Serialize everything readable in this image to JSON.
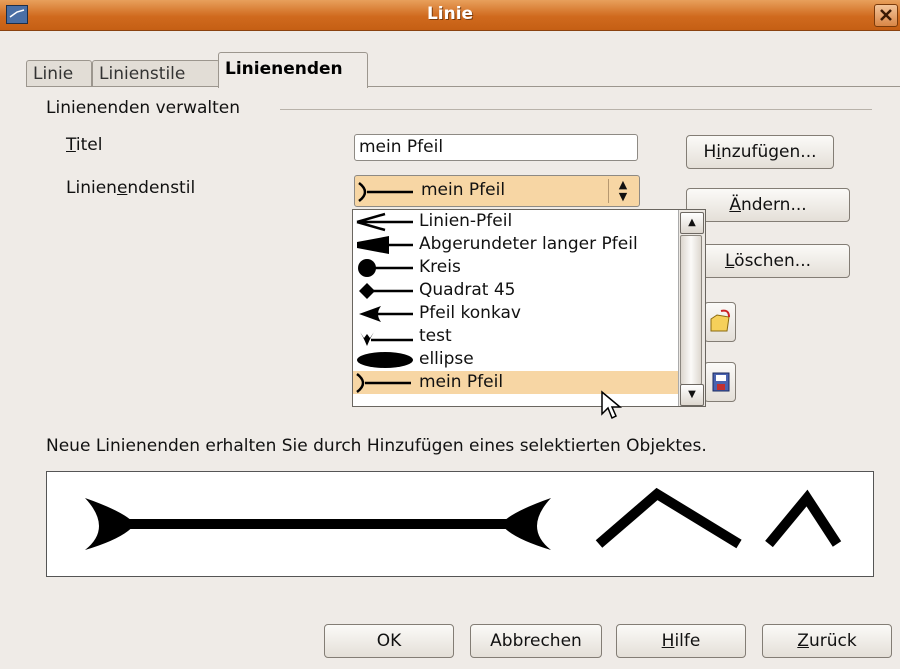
{
  "window": {
    "title": "Linie"
  },
  "tabs": [
    {
      "label": "Linie"
    },
    {
      "label": "Linienstile"
    },
    {
      "label": "Linienenden"
    }
  ],
  "section": {
    "label": "Linienenden verwalten"
  },
  "title_field": {
    "label_first": "T",
    "label_rest": "itel",
    "value": "mein Pfeil"
  },
  "style_field": {
    "label_pre": "Linien",
    "label_u": "e",
    "label_post": "ndenstil",
    "selected": "mein Pfeil"
  },
  "dropdown": {
    "items": [
      {
        "label": "Linien-Pfeil",
        "icon": "line-arrow-icon"
      },
      {
        "label": "Abgerundeter langer Pfeil",
        "icon": "rounded-long-arrow-icon"
      },
      {
        "label": "Kreis",
        "icon": "circle-end-icon"
      },
      {
        "label": "Quadrat 45",
        "icon": "diamond-end-icon"
      },
      {
        "label": "Pfeil konkav",
        "icon": "concave-arrow-icon"
      },
      {
        "label": "test",
        "icon": "test-end-icon"
      },
      {
        "label": "ellipse",
        "icon": "ellipse-end-icon"
      },
      {
        "label": "mein Pfeil",
        "icon": "custom-arrow-icon",
        "selected": true
      }
    ]
  },
  "buttons": {
    "add": {
      "pre": "H",
      "u": "i",
      "post": "nzufügen..."
    },
    "modify": {
      "pre": "",
      "u": "Ä",
      "post": "ndern..."
    },
    "delete": {
      "pre": "",
      "u": "L",
      "post": "öschen..."
    },
    "ok": "OK",
    "cancel": "Abbrechen",
    "help": {
      "u": "H",
      "post": "ilfe"
    },
    "back": {
      "u": "Z",
      "post": "urück"
    }
  },
  "hint": "Neue Linienenden erhalten Sie durch Hinzufügen eines selektierten Objektes.",
  "colors": {
    "titlebar": "#d06a1e",
    "selection": "#f7d6a4"
  }
}
